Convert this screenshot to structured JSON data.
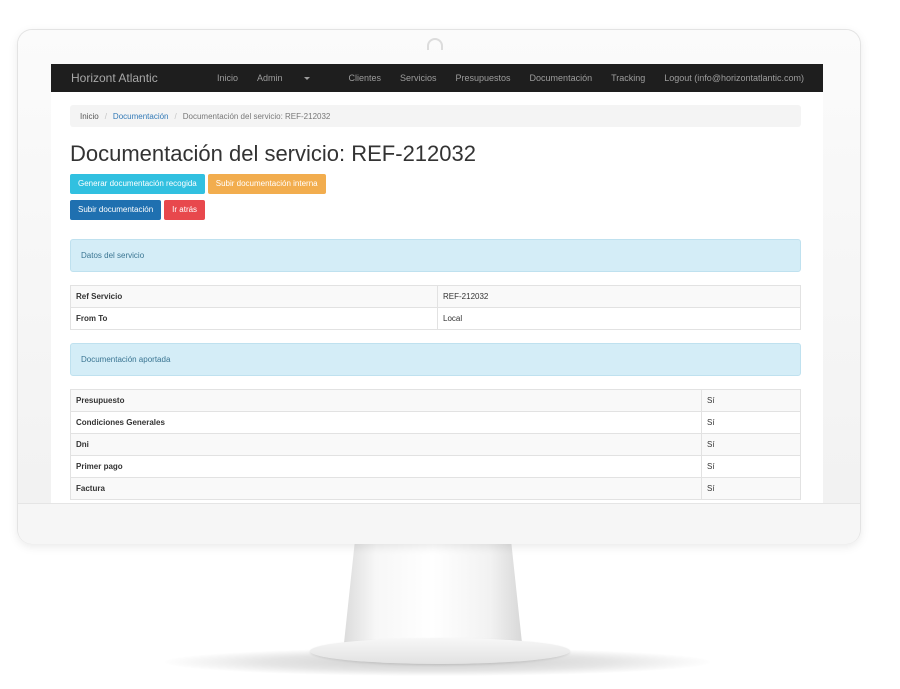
{
  "navbar": {
    "brand": "Horizont Atlantic",
    "items": [
      "Inicio",
      "Admin",
      "Clientes",
      "Servicios",
      "Presupuestos",
      "Documentación",
      "Tracking",
      "Logout (info@horizontatlantic.com)"
    ]
  },
  "breadcrumb": {
    "home": "Inicio",
    "section": "Documentación",
    "current": "Documentación del servicio: REF-212032"
  },
  "page_title": "Documentación del servicio: REF-212032",
  "buttons": {
    "generate": "Generar documentación recogida",
    "upload_internal": "Subir documentación interna",
    "upload": "Subir documentación",
    "back": "Ir atrás"
  },
  "service_panel": {
    "heading": "Datos del servicio",
    "rows": [
      {
        "label": "Ref Servicio",
        "value": "REF-212032"
      },
      {
        "label": "From To",
        "value": "Local"
      }
    ]
  },
  "docs_panel": {
    "heading": "Documentación aportada",
    "rows": [
      {
        "label": "Presupuesto",
        "value": "Sí"
      },
      {
        "label": "Condiciones Generales",
        "value": "Sí"
      },
      {
        "label": "Dni",
        "value": "Sí"
      },
      {
        "label": "Primer pago",
        "value": "Sí"
      },
      {
        "label": "Factura",
        "value": "Sí"
      }
    ]
  },
  "colors": {
    "navbar": "#1e1e1e",
    "btn_info": "#31c0e0",
    "btn_warning": "#f2ad4e",
    "btn_primary": "#1f70b0",
    "btn_danger": "#e8484d",
    "panel_heading": "#d4edf7",
    "link": "#337ab7"
  }
}
